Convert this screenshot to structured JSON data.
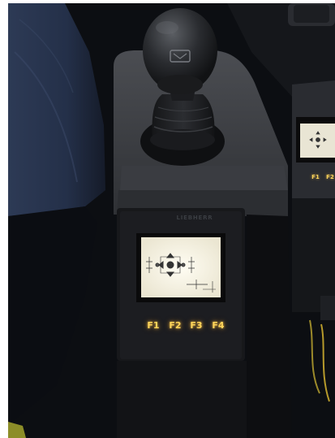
{
  "scene": {
    "brand": "LIEBHERR",
    "function_keys": [
      "F1",
      "F2",
      "F3",
      "F4"
    ],
    "side_panel_keys": [
      "F1",
      "F2"
    ]
  },
  "icons": {
    "joystick": "joystick-icon",
    "direction_arrows": "direction-arrows-icon"
  },
  "colors": {
    "backlight": "#ffd55a",
    "panel": "#3a3c42",
    "screen": "#f4f1e6"
  }
}
